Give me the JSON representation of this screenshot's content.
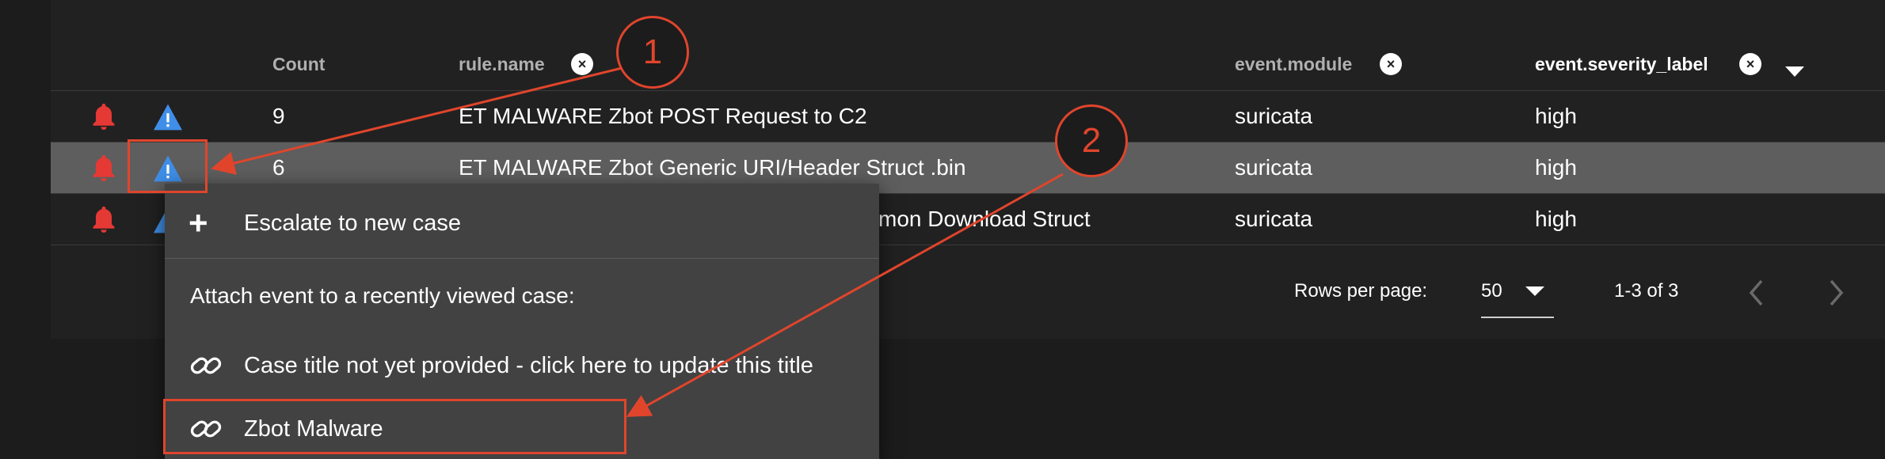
{
  "table": {
    "columns": [
      {
        "label": "Count",
        "removable": false
      },
      {
        "label": "rule.name",
        "removable": true
      },
      {
        "label": "event.module",
        "removable": true
      },
      {
        "label": "event.severity_label",
        "removable": true,
        "sorted": "descending"
      }
    ],
    "remove_symbol": "×",
    "rows": [
      {
        "count": "9",
        "rule_name": "ET MALWARE Zbot POST Request to C2",
        "event_module": "suricata",
        "severity": "high",
        "selected": false
      },
      {
        "count": "6",
        "rule_name": "ET MALWARE Zbot Generic URI/Header Struct .bin",
        "event_module": "suricata",
        "severity": "high",
        "selected": true
      },
      {
        "count": "",
        "rule_name": "mon Download Struct",
        "event_module": "suricata",
        "severity": "high",
        "selected": false
      }
    ]
  },
  "pagination": {
    "rows_per_page_label": "Rows per page:",
    "rows_per_page_value": "50",
    "range": "1-3 of 3"
  },
  "context_menu": {
    "escalate_label": "Escalate to new case",
    "escalate_icon": "+",
    "attach_label": "Attach event to a recently viewed case:",
    "cases": [
      {
        "title": "Case title not yet provided - click here to update this title"
      },
      {
        "title": "Zbot Malware"
      }
    ]
  },
  "annotations": {
    "badge_1": "1",
    "badge_2": "2",
    "color": "#e0452c"
  },
  "colors": {
    "bell_icon": "#e53935",
    "warning_icon": "#3f8ee8",
    "selected_row": "#5e5e5e"
  }
}
